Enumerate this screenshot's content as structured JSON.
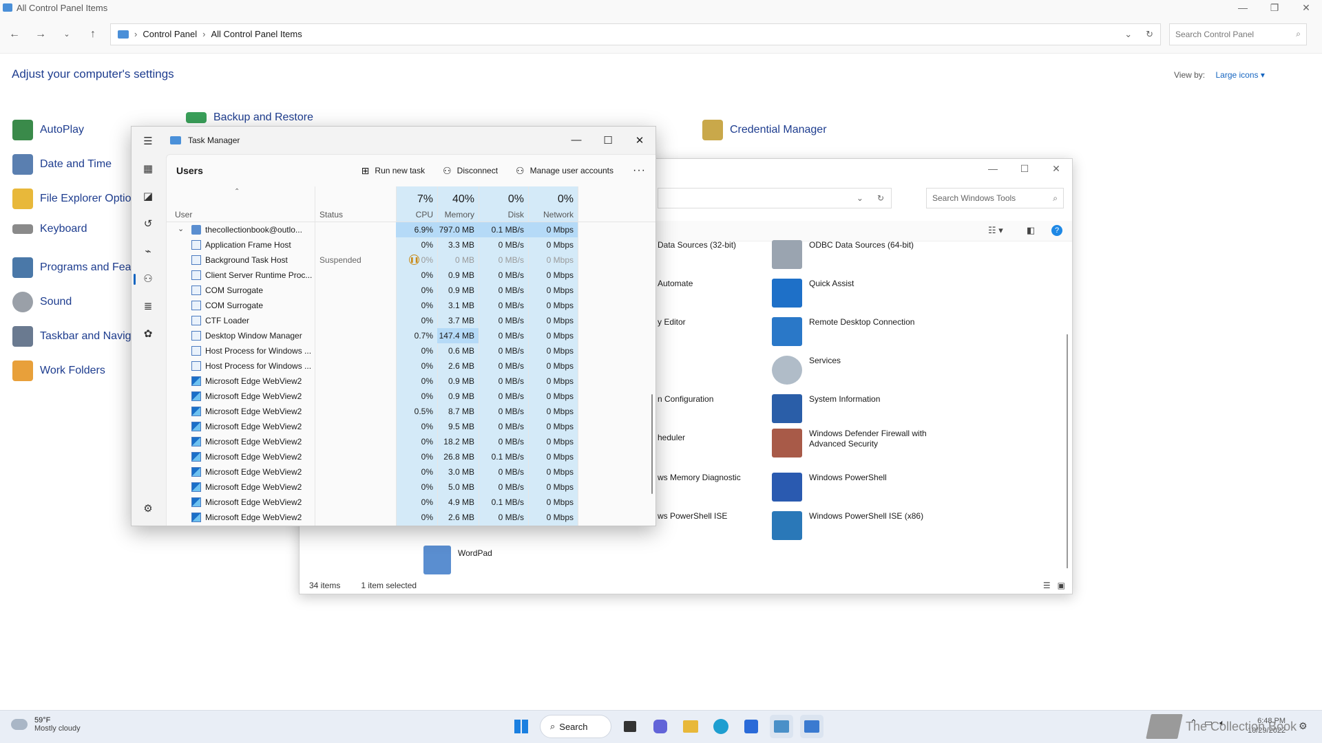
{
  "control_panel": {
    "title": "All Control Panel Items",
    "breadcrumb": [
      "Control Panel",
      "All Control Panel Items"
    ],
    "search_placeholder": "Search Control Panel",
    "heading": "Adjust your computer's settings",
    "view_by_label": "View by:",
    "view_by_value": "Large icons",
    "items_left": [
      "AutoPlay",
      "Date and Time",
      "File Explorer Optio",
      "Keyboard",
      "Programs and Feat",
      "Sound",
      "Taskbar and Navig",
      "Work Folders"
    ],
    "items_top": [
      "Backup and Restore",
      "Credential Manager"
    ]
  },
  "windows_tools": {
    "search_placeholder": "Search Windows Tools",
    "col1": [
      "Data Sources (32-bit)",
      "Automate",
      "y Editor",
      "n Configuration",
      "heduler",
      "ws Memory Diagnostic",
      "ws PowerShell ISE"
    ],
    "col2": [
      "ODBC Data Sources (64-bit)",
      "Quick Assist",
      "Remote Desktop Connection",
      "Services",
      "System Information",
      "Windows Defender Firewall with Advanced Security",
      "Windows PowerShell",
      "Windows PowerShell ISE (x86)"
    ],
    "wordpad": "WordPad",
    "status_items": "34 items",
    "status_selected": "1 item selected"
  },
  "task_manager": {
    "title": "Task Manager",
    "page": "Users",
    "commands": {
      "run": "Run new task",
      "disconnect": "Disconnect",
      "manage": "Manage user accounts"
    },
    "headers": {
      "user": "User",
      "status": "Status",
      "cpu_pct": "7%",
      "cpu": "CPU",
      "mem_pct": "40%",
      "mem": "Memory",
      "disk_pct": "0%",
      "disk": "Disk",
      "net_pct": "0%",
      "net": "Network"
    },
    "rows": [
      {
        "name": "thecollectionbook@outlo...",
        "status": "",
        "cpu": "6.9%",
        "mem": "797.0 MB",
        "disk": "0.1 MB/s",
        "net": "0 Mbps"
      },
      {
        "name": "Application Frame Host",
        "status": "",
        "cpu": "0%",
        "mem": "3.3 MB",
        "disk": "0 MB/s",
        "net": "0 Mbps"
      },
      {
        "name": "Background Task Host",
        "status": "Suspended",
        "cpu": "0%",
        "mem": "0 MB",
        "disk": "0 MB/s",
        "net": "0 Mbps"
      },
      {
        "name": "Client Server Runtime Proc...",
        "status": "",
        "cpu": "0%",
        "mem": "0.9 MB",
        "disk": "0 MB/s",
        "net": "0 Mbps"
      },
      {
        "name": "COM Surrogate",
        "status": "",
        "cpu": "0%",
        "mem": "0.9 MB",
        "disk": "0 MB/s",
        "net": "0 Mbps"
      },
      {
        "name": "COM Surrogate",
        "status": "",
        "cpu": "0%",
        "mem": "3.1 MB",
        "disk": "0 MB/s",
        "net": "0 Mbps"
      },
      {
        "name": "CTF Loader",
        "status": "",
        "cpu": "0%",
        "mem": "3.7 MB",
        "disk": "0 MB/s",
        "net": "0 Mbps"
      },
      {
        "name": "Desktop Window Manager",
        "status": "",
        "cpu": "0.7%",
        "mem": "147.4 MB",
        "disk": "0 MB/s",
        "net": "0 Mbps"
      },
      {
        "name": "Host Process for Windows ...",
        "status": "",
        "cpu": "0%",
        "mem": "0.6 MB",
        "disk": "0 MB/s",
        "net": "0 Mbps"
      },
      {
        "name": "Host Process for Windows ...",
        "status": "",
        "cpu": "0%",
        "mem": "2.6 MB",
        "disk": "0 MB/s",
        "net": "0 Mbps"
      },
      {
        "name": "Microsoft Edge WebView2",
        "status": "",
        "cpu": "0%",
        "mem": "0.9 MB",
        "disk": "0 MB/s",
        "net": "0 Mbps"
      },
      {
        "name": "Microsoft Edge WebView2",
        "status": "",
        "cpu": "0%",
        "mem": "0.9 MB",
        "disk": "0 MB/s",
        "net": "0 Mbps"
      },
      {
        "name": "Microsoft Edge WebView2",
        "status": "",
        "cpu": "0.5%",
        "mem": "8.7 MB",
        "disk": "0 MB/s",
        "net": "0 Mbps"
      },
      {
        "name": "Microsoft Edge WebView2",
        "status": "",
        "cpu": "0%",
        "mem": "9.5 MB",
        "disk": "0 MB/s",
        "net": "0 Mbps"
      },
      {
        "name": "Microsoft Edge WebView2",
        "status": "",
        "cpu": "0%",
        "mem": "18.2 MB",
        "disk": "0 MB/s",
        "net": "0 Mbps"
      },
      {
        "name": "Microsoft Edge WebView2",
        "status": "",
        "cpu": "0%",
        "mem": "26.8 MB",
        "disk": "0.1 MB/s",
        "net": "0 Mbps"
      },
      {
        "name": "Microsoft Edge WebView2",
        "status": "",
        "cpu": "0%",
        "mem": "3.0 MB",
        "disk": "0 MB/s",
        "net": "0 Mbps"
      },
      {
        "name": "Microsoft Edge WebView2",
        "status": "",
        "cpu": "0%",
        "mem": "5.0 MB",
        "disk": "0 MB/s",
        "net": "0 Mbps"
      },
      {
        "name": "Microsoft Edge WebView2",
        "status": "",
        "cpu": "0%",
        "mem": "4.9 MB",
        "disk": "0.1 MB/s",
        "net": "0 Mbps"
      },
      {
        "name": "Microsoft Edge WebView2",
        "status": "",
        "cpu": "0%",
        "mem": "2.6 MB",
        "disk": "0 MB/s",
        "net": "0 Mbps"
      }
    ]
  },
  "taskbar": {
    "temp": "59°F",
    "condition": "Mostly cloudy",
    "search_label": "Search",
    "time": "6:48 PM",
    "date": "10/29/2022"
  },
  "watermark": "The Collection Book",
  "colors": {
    "accent": "#1565c0",
    "highlight": "#d4eaf8",
    "link": "#1e3d8f"
  }
}
